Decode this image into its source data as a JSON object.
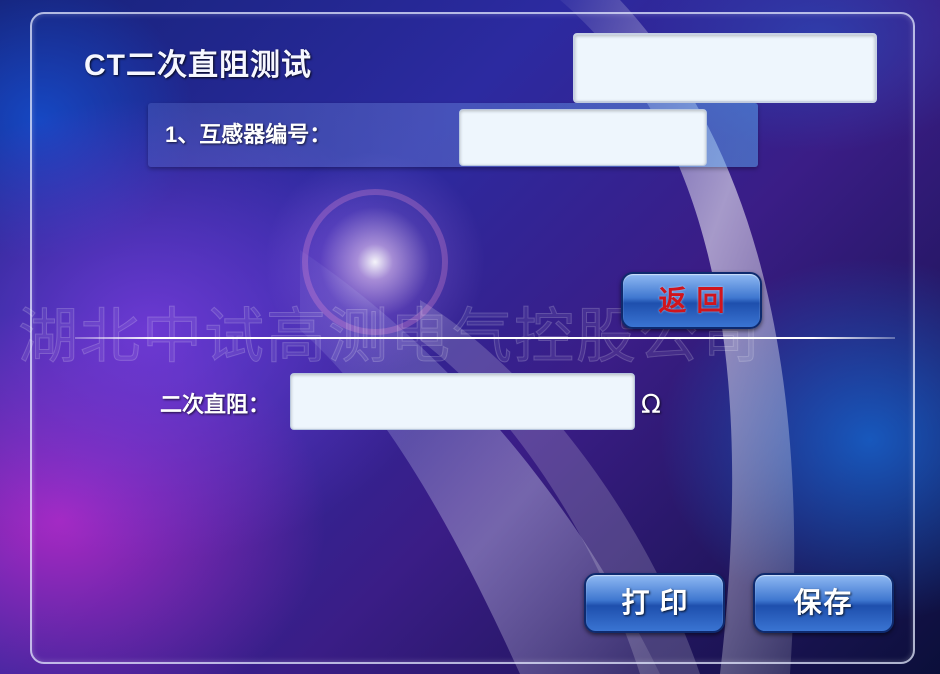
{
  "title": "CT二次直阻测试",
  "header": {
    "top_field_value": ""
  },
  "section1": {
    "label": "1、互感器编号：",
    "transformer_number_value": ""
  },
  "buttons": {
    "back_label": "返回",
    "print_label": "打印",
    "save_label": "保存"
  },
  "result": {
    "label": "二次直阻：",
    "value": "",
    "unit": "Ω"
  },
  "watermark": "湖北中试高测电气控股公司",
  "colors": {
    "back_text": "#d0141c",
    "button_blue": "#3f77d0",
    "field_bg": "#eef6fd"
  }
}
